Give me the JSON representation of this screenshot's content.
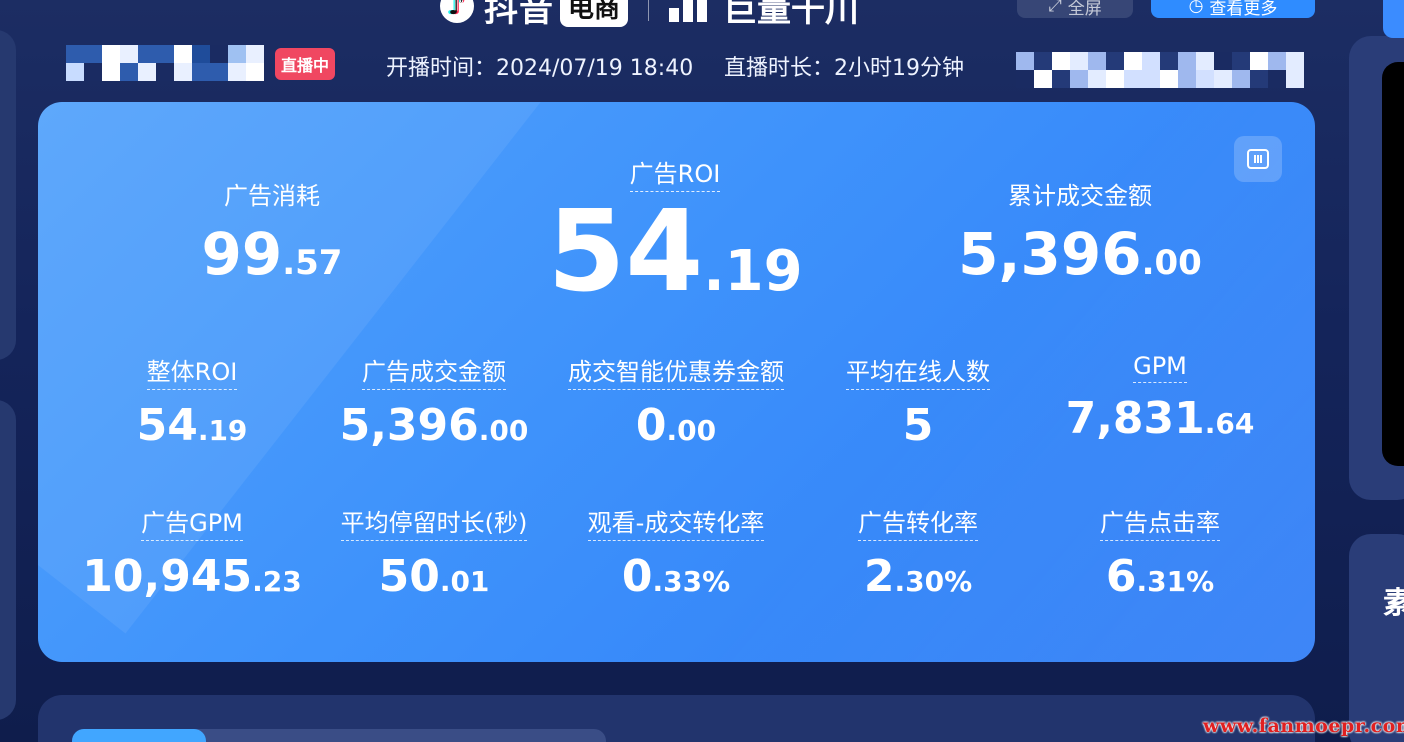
{
  "header": {
    "douyin_text": "抖音",
    "dianshang_text": "电商",
    "qianchuan_text": "巨量千川",
    "ghost_button_label": "全屏",
    "primary_button_label": "查看更多",
    "live_badge": "直播中",
    "start_time": "开播时间：2024/07/19 18:40",
    "duration": "直播时长：2小时19分钟"
  },
  "hero": {
    "ad_spend": {
      "label": "广告消耗",
      "int": "99",
      "dec": ".57"
    },
    "ad_roi": {
      "label": "广告ROI",
      "int": "54",
      "dec": ".19"
    },
    "total_gmv": {
      "label": "累计成交金额",
      "int": "5,396",
      "dec": ".00"
    }
  },
  "metrics_row1": [
    {
      "label": "整体ROI",
      "int": "54",
      "dec": ".19"
    },
    {
      "label": "广告成交金额",
      "int": "5,396",
      "dec": ".00"
    },
    {
      "label": "成交智能优惠券金额",
      "int": "0",
      "dec": ".00"
    },
    {
      "label": "平均在线人数",
      "int": "5",
      "dec": ""
    },
    {
      "label": "GPM",
      "int": "7,831",
      "dec": ".64"
    }
  ],
  "metrics_row2": [
    {
      "label": "广告GPM",
      "int": "10,945",
      "dec": ".23"
    },
    {
      "label": "平均停留时长(秒)",
      "int": "50",
      "dec": ".01"
    },
    {
      "label": "观看-成交转化率",
      "int": "0",
      "dec": ".33%"
    },
    {
      "label": "广告转化率",
      "int": "2",
      "dec": ".30%"
    },
    {
      "label": "广告点击率",
      "int": "6",
      "dec": ".31%"
    }
  ],
  "right_panel_char": "素",
  "watermark": "www.fanmoepr.com",
  "colors": {
    "card_start": "#52a2fb",
    "card_end": "#2d7bf6",
    "live_badge": "#f04761",
    "accent": "#2f8cff"
  },
  "icons": {
    "settings": "columns-icon",
    "fullscreen": "expand-icon",
    "more": "circle-icon"
  }
}
